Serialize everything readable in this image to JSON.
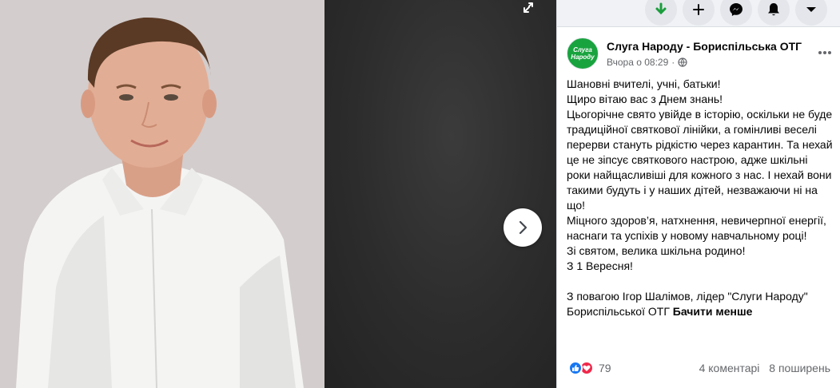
{
  "topbar": {
    "icons": [
      "download-arrow-icon",
      "plus-icon",
      "messenger-icon",
      "bell-icon",
      "caret-down-icon"
    ]
  },
  "post": {
    "page_name": "Слуга Народу - Бориспільська ОТГ",
    "avatar_text_line1": "Слуга",
    "avatar_text_line2": "Народу",
    "time": "Вчора о 08:29",
    "body": "Шановні вчителі, учні, батьки!\nЩиро вітаю вас з Днем знань!\nЦьогорічне свято увійде в історію, оскільки не буде традиційної святкової лінійки, а гомінливі веселі перерви стануть рідкістю через карантин. Та нехай це не зіпсує святкового настрою, адже шкільні роки найщасливіші для кожного з нас. І нехай вони такими будуть і у наших дітей, незважаючи ні на що!\nМіцного здоров’я, натхнення, невичерпної енергії, наснаги та успіхів у новому навчальному році!\nЗі святом, велика шкільна родино!\nЗ 1 Вересня!\n\nЗ повагою Ігор Шалімов, лідер \"Слуги Народу\" Бориспільської ОТГ",
    "see_less": "Бачити менше"
  },
  "footer": {
    "reaction_count": "79",
    "comments": "4 коментарі",
    "shares": "8 поширень"
  },
  "colors": {
    "brand_green": "#19a33f",
    "facebook_blue": "#1877f2",
    "love_red": "#f0284a",
    "secondary_text": "#65676b"
  }
}
